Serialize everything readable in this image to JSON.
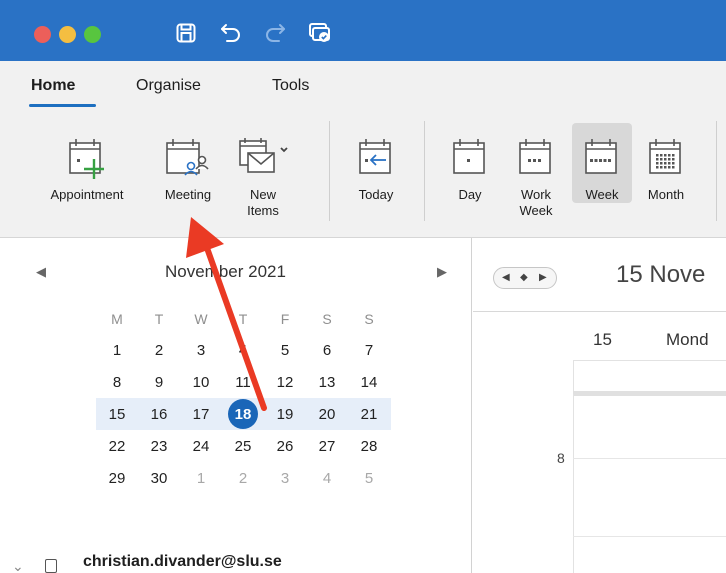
{
  "ribbon": {
    "tabs": [
      {
        "label": "Home",
        "active": true
      },
      {
        "label": "Organise",
        "active": false
      },
      {
        "label": "Tools",
        "active": false
      }
    ],
    "buttons": {
      "appointment": "Appointment",
      "meeting": "Meeting",
      "new_items_line1": "New",
      "new_items_line2": "Items",
      "today": "Today",
      "day": "Day",
      "work_week_line1": "Work",
      "work_week_line2": "Week",
      "week": "Week",
      "month": "Month"
    }
  },
  "mini_calendar": {
    "month_label": "November 2021",
    "weekday_headers": [
      "M",
      "T",
      "W",
      "T",
      "F",
      "S",
      "S"
    ],
    "weeks": [
      [
        "1",
        "2",
        "3",
        "4",
        "5",
        "6",
        "7"
      ],
      [
        "8",
        "9",
        "10",
        "11",
        "12",
        "13",
        "14"
      ],
      [
        "15",
        "16",
        "17",
        "18",
        "19",
        "20",
        "21"
      ],
      [
        "22",
        "23",
        "24",
        "25",
        "26",
        "27",
        "28"
      ],
      [
        "29",
        "30",
        "1",
        "2",
        "3",
        "4",
        "5"
      ]
    ],
    "today": "18"
  },
  "account": {
    "email": "christian.divander@slu.se"
  },
  "calendar_view": {
    "date_range": "15 Nove",
    "day_number": "15",
    "day_name": "Mond",
    "hour_label": "8"
  },
  "colors": {
    "titlebar": "#2a72c5",
    "accent": "#1d6fc0",
    "today_circle": "#1a66b8",
    "annotation_arrow": "#ea3a24"
  }
}
